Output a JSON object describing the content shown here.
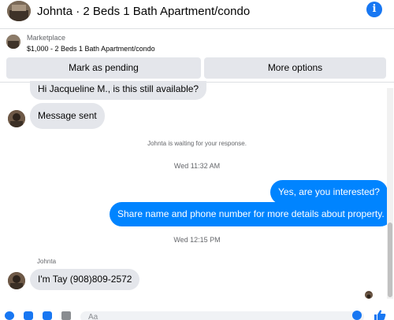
{
  "header": {
    "title": "Johnta · 2 Beds 1 Bath Apartment/condo",
    "info_glyph": "i"
  },
  "marketplace": {
    "label": "Marketplace",
    "listing": "$1,000 - 2 Beds 1 Bath Apartment/condo",
    "mark_pending_label": "Mark as pending",
    "more_options_label": "More options"
  },
  "messages": {
    "outgoing_first": "Hi Jacqueline M., is this still available?",
    "message_sent": "Message sent",
    "waiting_note": "Johnta is waiting for your response.",
    "timestamp_1": "Wed 11:32 AM",
    "reply_1": "Yes, are you interested?",
    "reply_2": "Share name and phone number for more details about property.",
    "timestamp_2": "Wed 12:15 PM",
    "sender_name": "Johnta",
    "incoming_phone": "I'm Tay (908)809-2572"
  },
  "composer": {
    "placeholder": "Aa"
  },
  "colors": {
    "accent": "#1877f2",
    "outgoing_bubble": "#0084ff",
    "incoming_bubble": "#e4e6eb"
  },
  "icons": [
    "info-icon",
    "add-icon",
    "photo-icon",
    "sticker-icon",
    "gif-icon",
    "emoji-icon",
    "like-icon"
  ]
}
